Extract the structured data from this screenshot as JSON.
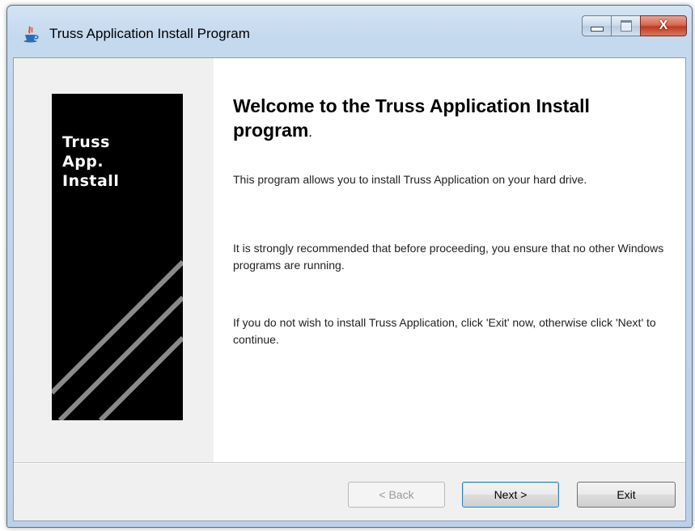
{
  "window": {
    "title": "Truss Application Install Program",
    "icon": "java-cup-icon",
    "caption_buttons": {
      "minimize": "minimize-icon",
      "maximize": "maximize-icon",
      "close_label": "X"
    }
  },
  "banner": {
    "lines": [
      "Truss",
      "App.",
      "Install"
    ]
  },
  "content": {
    "heading_main": "Welcome to the Truss Application Install program",
    "heading_period": ".",
    "paragraphs": [
      "This program allows you to install Truss Application on your hard drive.",
      "It is strongly recommended that before proceeding, you ensure that no other Windows programs are running.",
      "If you do not wish to install Truss Application, click 'Exit' now, otherwise click 'Next' to continue."
    ]
  },
  "buttons": {
    "back": "< Back",
    "next": "Next >",
    "exit": "Exit"
  }
}
